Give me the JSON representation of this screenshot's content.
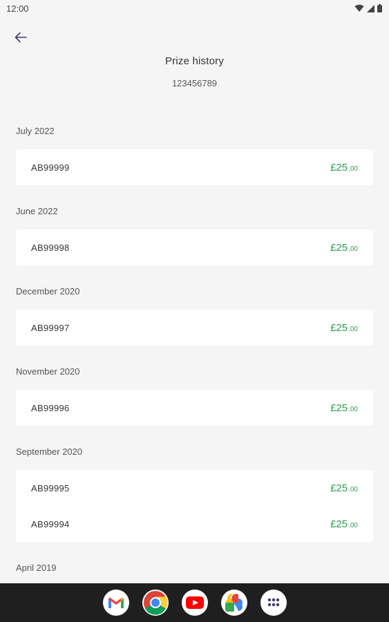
{
  "status_bar": {
    "time": "12:00"
  },
  "header": {
    "title": "Prize history",
    "subtitle": "123456789"
  },
  "groups": [
    {
      "label": "July 2022",
      "items": [
        {
          "id": "AB99999",
          "amount_main": "£25",
          "amount_decimal": ".00"
        }
      ]
    },
    {
      "label": "June 2022",
      "items": [
        {
          "id": "AB99998",
          "amount_main": "£25",
          "amount_decimal": ".00"
        }
      ]
    },
    {
      "label": "December 2020",
      "items": [
        {
          "id": "AB99997",
          "amount_main": "£25",
          "amount_decimal": ".00"
        }
      ]
    },
    {
      "label": "November 2020",
      "items": [
        {
          "id": "AB99996",
          "amount_main": "£25",
          "amount_decimal": ".00"
        }
      ]
    },
    {
      "label": "September 2020",
      "items": [
        {
          "id": "AB99995",
          "amount_main": "£25",
          "amount_decimal": ".00"
        },
        {
          "id": "AB99994",
          "amount_main": "£25",
          "amount_decimal": ".00"
        }
      ]
    },
    {
      "label": "April 2019",
      "items": []
    }
  ],
  "dock": [
    "gmail-icon",
    "chrome-icon",
    "youtube-icon",
    "photos-icon",
    "app-drawer-icon"
  ],
  "colors": {
    "amount": "#2e9c4f",
    "background": "#f5f5f6",
    "back_arrow": "#3b3a6e"
  }
}
